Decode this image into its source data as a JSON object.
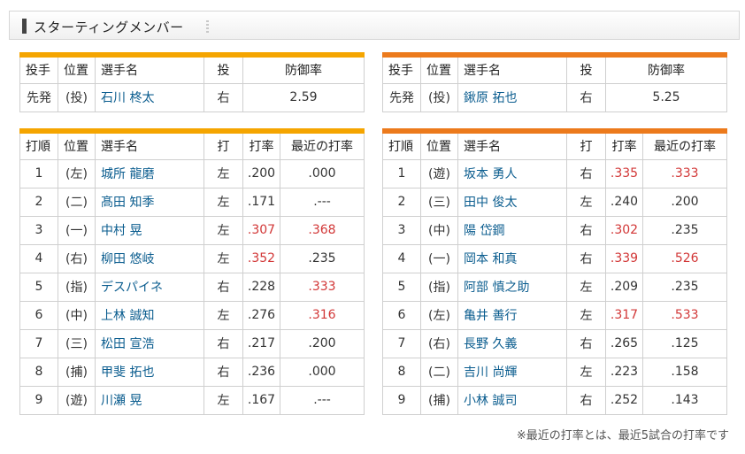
{
  "header": {
    "title": "スターティングメンバー"
  },
  "pitcher_headers": [
    "投手",
    "位置",
    "選手名",
    "投",
    "防御率"
  ],
  "batter_headers": [
    "打順",
    "位置",
    "選手名",
    "打",
    "打率",
    "最近の打率"
  ],
  "left": {
    "pitcher": {
      "role": "先発",
      "pos": "(投)",
      "name": "石川 柊太",
      "hand": "右",
      "era": "2.59"
    },
    "batters": [
      {
        "order": "1",
        "pos": "(左)",
        "name": "城所 龍磨",
        "hand": "左",
        "avg": ".200",
        "recent": ".000",
        "avg_red": false,
        "recent_red": false
      },
      {
        "order": "2",
        "pos": "(二)",
        "name": "髙田 知季",
        "hand": "左",
        "avg": ".171",
        "recent": ".---",
        "avg_red": false,
        "recent_red": false
      },
      {
        "order": "3",
        "pos": "(一)",
        "name": "中村 晃",
        "hand": "左",
        "avg": ".307",
        "recent": ".368",
        "avg_red": true,
        "recent_red": true
      },
      {
        "order": "4",
        "pos": "(右)",
        "name": "柳田 悠岐",
        "hand": "左",
        "avg": ".352",
        "recent": ".235",
        "avg_red": true,
        "recent_red": false
      },
      {
        "order": "5",
        "pos": "(指)",
        "name": "デスパイネ",
        "hand": "右",
        "avg": ".228",
        "recent": ".333",
        "avg_red": false,
        "recent_red": true
      },
      {
        "order": "6",
        "pos": "(中)",
        "name": "上林 誠知",
        "hand": "左",
        "avg": ".276",
        "recent": ".316",
        "avg_red": false,
        "recent_red": true
      },
      {
        "order": "7",
        "pos": "(三)",
        "name": "松田 宣浩",
        "hand": "右",
        "avg": ".217",
        "recent": ".200",
        "avg_red": false,
        "recent_red": false
      },
      {
        "order": "8",
        "pos": "(捕)",
        "name": "甲斐 拓也",
        "hand": "右",
        "avg": ".236",
        "recent": ".000",
        "avg_red": false,
        "recent_red": false
      },
      {
        "order": "9",
        "pos": "(遊)",
        "name": "川瀬 晃",
        "hand": "左",
        "avg": ".167",
        "recent": ".---",
        "avg_red": false,
        "recent_red": false
      }
    ]
  },
  "right": {
    "pitcher": {
      "role": "先発",
      "pos": "(投)",
      "name": "鍬原 拓也",
      "hand": "右",
      "era": "5.25"
    },
    "batters": [
      {
        "order": "1",
        "pos": "(遊)",
        "name": "坂本 勇人",
        "hand": "右",
        "avg": ".335",
        "recent": ".333",
        "avg_red": true,
        "recent_red": true
      },
      {
        "order": "2",
        "pos": "(三)",
        "name": "田中 俊太",
        "hand": "左",
        "avg": ".240",
        "recent": ".200",
        "avg_red": false,
        "recent_red": false
      },
      {
        "order": "3",
        "pos": "(中)",
        "name": "陽 岱鋼",
        "hand": "右",
        "avg": ".302",
        "recent": ".235",
        "avg_red": true,
        "recent_red": false
      },
      {
        "order": "4",
        "pos": "(一)",
        "name": "岡本 和真",
        "hand": "右",
        "avg": ".339",
        "recent": ".526",
        "avg_red": true,
        "recent_red": true
      },
      {
        "order": "5",
        "pos": "(指)",
        "name": "阿部 慎之助",
        "hand": "左",
        "avg": ".209",
        "recent": ".235",
        "avg_red": false,
        "recent_red": false
      },
      {
        "order": "6",
        "pos": "(左)",
        "name": "亀井 善行",
        "hand": "左",
        "avg": ".317",
        "recent": ".533",
        "avg_red": true,
        "recent_red": true
      },
      {
        "order": "7",
        "pos": "(右)",
        "name": "長野 久義",
        "hand": "右",
        "avg": ".265",
        "recent": ".125",
        "avg_red": false,
        "recent_red": false
      },
      {
        "order": "8",
        "pos": "(二)",
        "name": "吉川 尚輝",
        "hand": "左",
        "avg": ".223",
        "recent": ".158",
        "avg_red": false,
        "recent_red": false
      },
      {
        "order": "9",
        "pos": "(捕)",
        "name": "小林 誠司",
        "hand": "右",
        "avg": ".252",
        "recent": ".143",
        "avg_red": false,
        "recent_red": false
      }
    ]
  },
  "note": "※最近の打率とは、最近5試合の打率です",
  "colors": {
    "left_accent": "#f5a500",
    "right_accent": "#ec7a1c",
    "highlight": "#d23737",
    "link": "#0b5d8f"
  }
}
